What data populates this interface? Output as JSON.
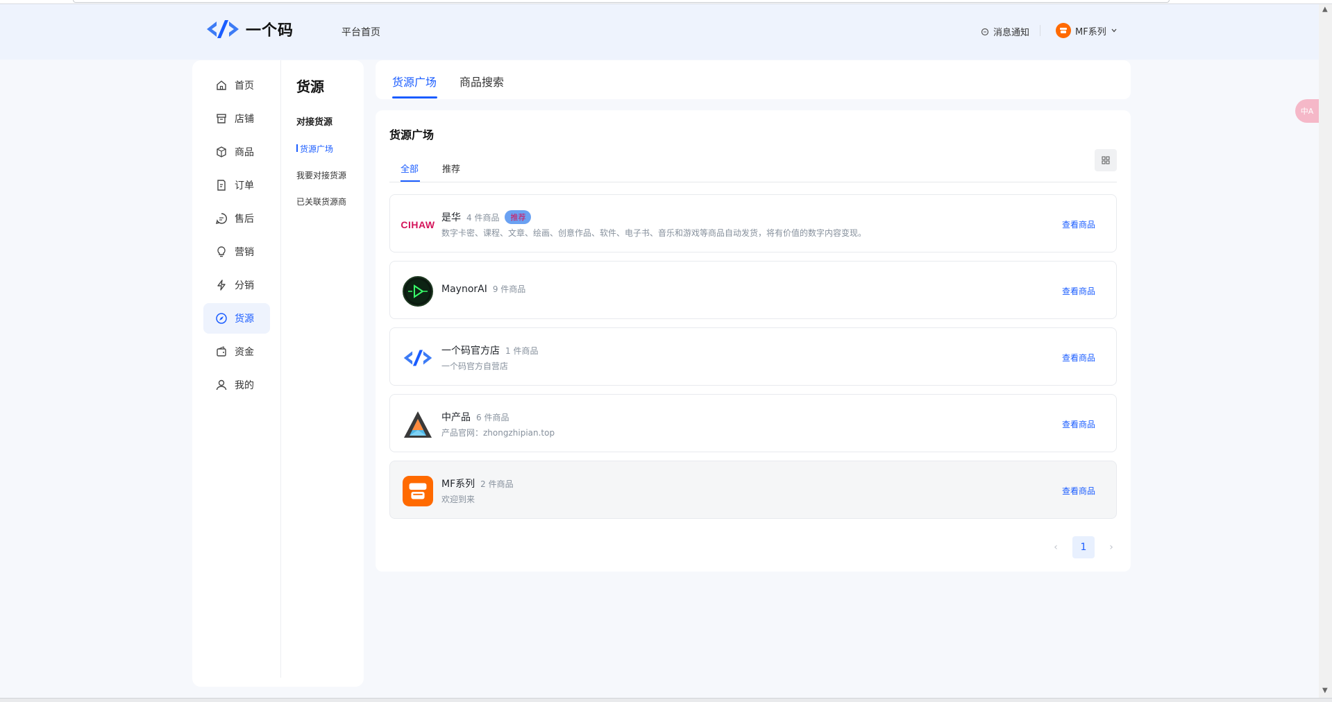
{
  "app": {
    "logo_text": "一个码"
  },
  "header": {
    "platform_home": "平台首页",
    "notifications": "消息通知",
    "user_name": "MF系列"
  },
  "nav_primary": [
    {
      "label": "首页",
      "icon": "home-icon"
    },
    {
      "label": "店铺",
      "icon": "store-icon"
    },
    {
      "label": "商品",
      "icon": "box-icon"
    },
    {
      "label": "订单",
      "icon": "order-icon"
    },
    {
      "label": "售后",
      "icon": "after-sale-icon"
    },
    {
      "label": "营销",
      "icon": "bulb-icon"
    },
    {
      "label": "分销",
      "icon": "lightning-icon"
    },
    {
      "label": "货源",
      "icon": "compass-icon",
      "active": true
    },
    {
      "label": "资金",
      "icon": "wallet-icon"
    },
    {
      "label": "我的",
      "icon": "user-icon"
    }
  ],
  "nav_secondary": {
    "title": "货源",
    "group": "对接货源",
    "items": [
      "货源广场",
      "我要对接货源",
      "已关联货源商"
    ]
  },
  "main_tabs": [
    "货源广场",
    "商品搜索"
  ],
  "content": {
    "title": "货源广场",
    "sub_tabs": [
      "全部",
      "推荐"
    ]
  },
  "suppliers": [
    {
      "name": "是华",
      "count": "4 件商品",
      "badge": "推荐",
      "logo_text": "CIHAW",
      "desc": "数字卡密、课程、文章、绘画、创意作品、软件、电子书、音乐和游戏等商品自动发货，将有价值的数字内容变现。",
      "action": "查看商品"
    },
    {
      "name": "MaynorAI",
      "count": "9 件商品",
      "desc": "",
      "action": "查看商品"
    },
    {
      "name": "一个码官方店",
      "count": "1 件商品",
      "desc": "一个码官方自营店",
      "action": "查看商品"
    },
    {
      "name": "中产品",
      "count": "6 件商品",
      "desc": "产品官网：zhongzhipian.top",
      "action": "查看商品"
    },
    {
      "name": "MF系列",
      "count": "2 件商品",
      "desc": "欢迎到来",
      "action": "查看商品"
    }
  ],
  "pagination": {
    "current": "1",
    "prev": "‹",
    "next": "›"
  },
  "translate_widget": "中A",
  "colors": {
    "accent": "#1a5cff",
    "badge_bg": "#6aa1f2",
    "brand_orange": "#ff6a00"
  }
}
